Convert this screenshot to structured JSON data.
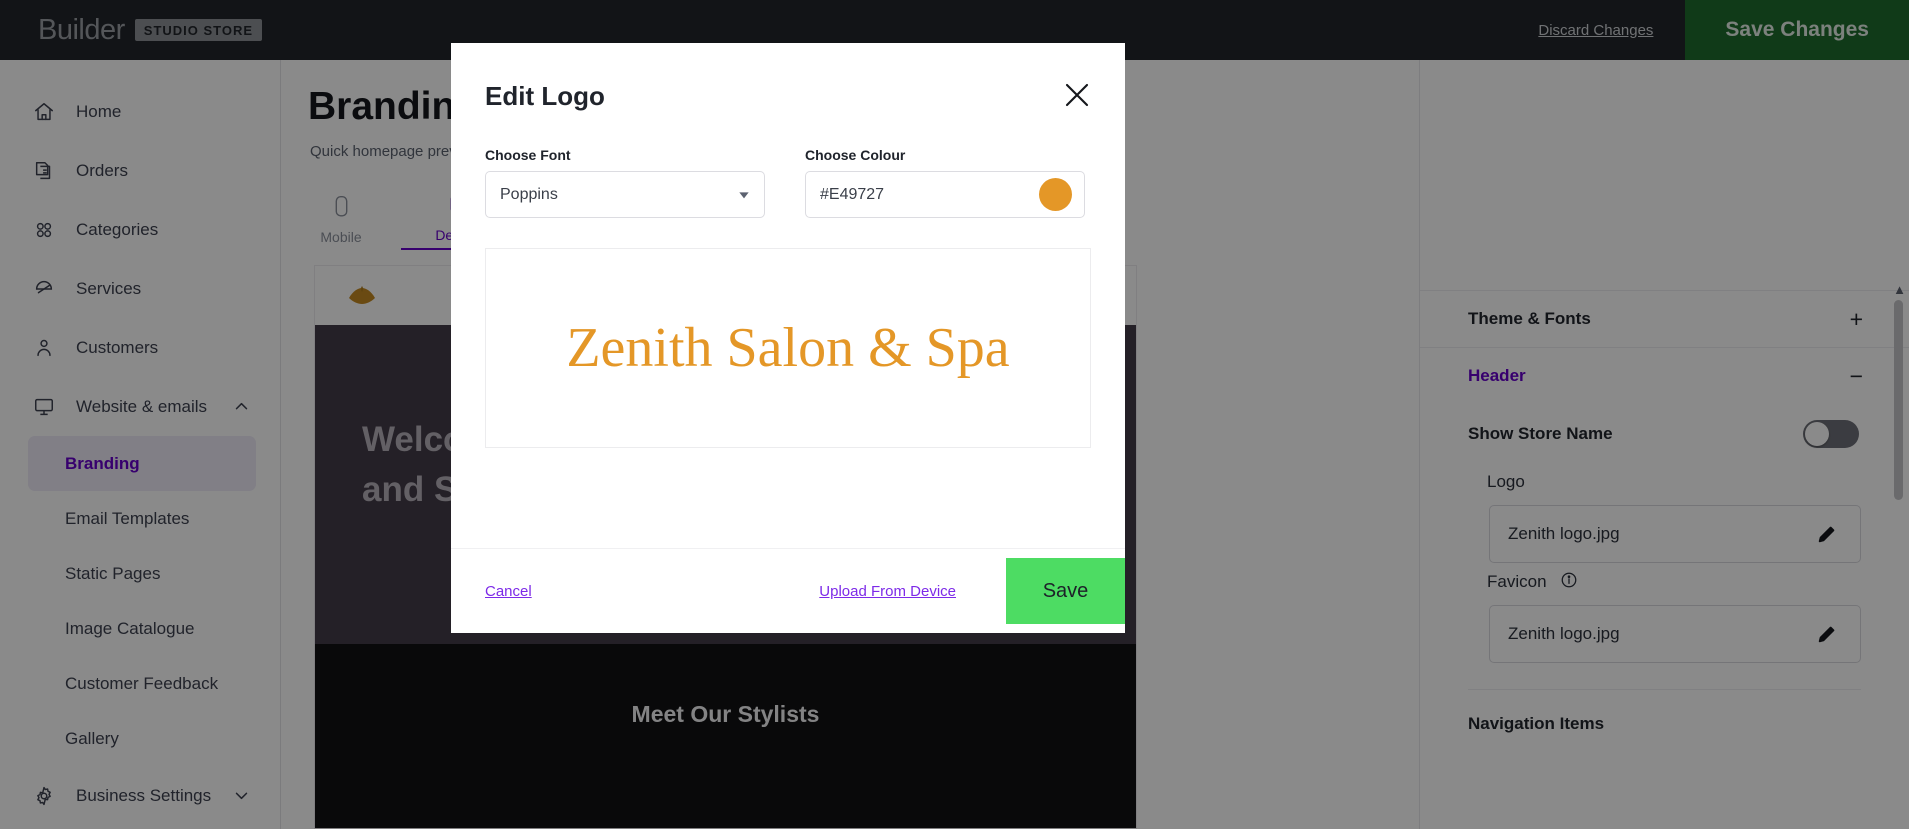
{
  "topbar": {
    "brand_name": "Builder",
    "brand_chip": "STUDIO STORE",
    "discard_label": "Discard Changes",
    "save_label": "Save Changes",
    "save_color": "#1f6b2e"
  },
  "sidebar": {
    "items": [
      {
        "label": "Home",
        "icon": "home-icon"
      },
      {
        "label": "Orders",
        "icon": "orders-icon"
      },
      {
        "label": "Categories",
        "icon": "categories-icon"
      },
      {
        "label": "Services",
        "icon": "services-icon"
      },
      {
        "label": "Customers",
        "icon": "customers-icon"
      },
      {
        "label": "Website & emails",
        "icon": "monitor-icon",
        "expanded": true
      }
    ],
    "sub_items": [
      {
        "label": "Branding",
        "active": true
      },
      {
        "label": "Email Templates",
        "active": false
      },
      {
        "label": "Static Pages",
        "active": false
      },
      {
        "label": "Image Catalogue",
        "active": false
      },
      {
        "label": "Customer Feedback",
        "active": false
      },
      {
        "label": "Gallery",
        "active": false
      }
    ],
    "settings_item": {
      "label": "Business Settings",
      "icon": "gear-icon"
    },
    "active_color": "#6600cc"
  },
  "main": {
    "page_title": "Branding",
    "page_subtitle": "Quick homepage preview",
    "tabs": [
      {
        "label": "Mobile",
        "icon": "mobile-icon",
        "active": false
      },
      {
        "label": "Desktop",
        "icon": "desktop-icon",
        "active": true
      }
    ],
    "preview": {
      "hero_line1": "Welcome",
      "hero_line2": "and Spa",
      "section_title": "Meet Our Stylists"
    }
  },
  "right_panel": {
    "sections": [
      {
        "label": "Theme & Fonts",
        "sign": "+",
        "open": false
      },
      {
        "label": "Header",
        "sign": "−",
        "open": true
      }
    ],
    "show_store_name": {
      "label": "Show Store Name",
      "enabled": false
    },
    "logo": {
      "label": "Logo",
      "value": "Zenith logo.jpg"
    },
    "favicon": {
      "label": "Favicon",
      "value": "Zenith logo.jpg",
      "has_info": true
    },
    "navigation_items_label": "Navigation Items"
  },
  "modal": {
    "title": "Edit Logo",
    "close_icon": "close-icon",
    "font_field": {
      "label": "Choose Font",
      "value": "Poppins"
    },
    "colour_field": {
      "label": "Choose Colour",
      "value": "#E49727",
      "swatch": "#E49727"
    },
    "preview_text": "Zenith Salon & Spa",
    "preview_color": "#E49727",
    "cancel_label": "Cancel",
    "upload_label": "Upload From Device",
    "save_label": "Save",
    "save_color": "#4ddc63",
    "link_color": "#7d2ae8"
  }
}
